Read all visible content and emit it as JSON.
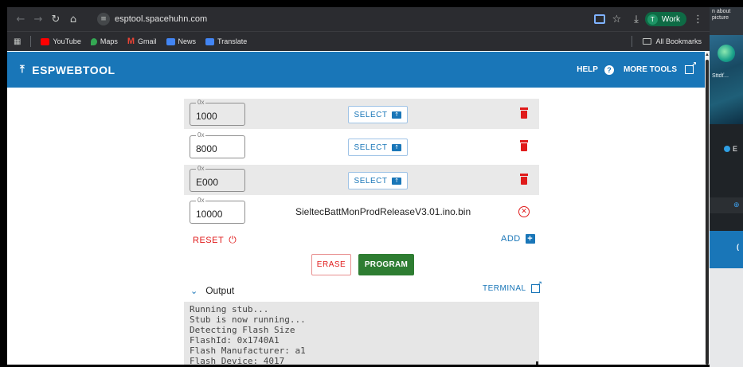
{
  "browser": {
    "url": "esptool.spacehuhn.com",
    "profile_initial": "T",
    "profile_name": "Work",
    "bookmarks": [
      {
        "label": "YouTube",
        "color": "#ff0000"
      },
      {
        "label": "Maps",
        "color": "#34a853"
      },
      {
        "label": "Gmail",
        "color": "#ea4335"
      },
      {
        "label": "News",
        "color": "#4285f4"
      },
      {
        "label": "Translate",
        "color": "#4285f4"
      }
    ],
    "all_bookmarks": "All Bookmarks"
  },
  "header": {
    "title": "ESPWEBTOOL",
    "help_label": "HELP",
    "more_tools_label": "MORE TOOLS",
    "accent": "#1976b8"
  },
  "rows": [
    {
      "prefix": "0x",
      "offset": "1000",
      "select_label": "SELECT",
      "filename": null
    },
    {
      "prefix": "0x",
      "offset": "8000",
      "select_label": "SELECT",
      "filename": null
    },
    {
      "prefix": "0x",
      "offset": "E000",
      "select_label": "SELECT",
      "filename": null
    },
    {
      "prefix": "0x",
      "offset": "10000",
      "select_label": null,
      "filename": "SieltecBattMonProdReleaseV3.01.ino.bin"
    }
  ],
  "actions": {
    "reset_label": "RESET",
    "add_label": "ADD",
    "erase_label": "ERASE",
    "program_label": "PROGRAM",
    "program_color": "#2e7d32",
    "danger_color": "#e01b1b"
  },
  "output": {
    "toggle_label": "Output",
    "terminal_label": "TERMINAL",
    "lines": [
      "Running stub...",
      "Stub is now running...",
      "Detecting Flash Size",
      "FlashId: 0x1740A1",
      "Flash Manufacturer: a1",
      "Flash Device: 4017"
    ]
  },
  "side_panel": {
    "top_text_1": "n about",
    "top_text_2": "picture",
    "caption": "Sttdť...",
    "e_label": "E",
    "blue_label": "("
  }
}
